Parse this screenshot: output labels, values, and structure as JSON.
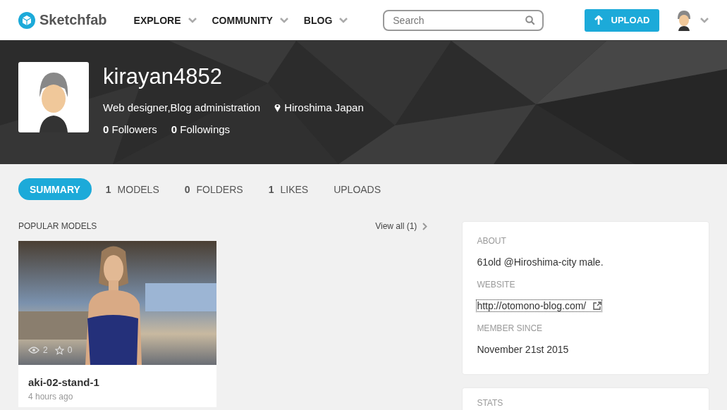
{
  "header": {
    "logo": "Sketchfab",
    "nav": [
      {
        "label": "EXPLORE"
      },
      {
        "label": "COMMUNITY"
      },
      {
        "label": "BLOG"
      }
    ],
    "search": {
      "placeholder": "Search"
    },
    "upload": "UPLOAD"
  },
  "profile": {
    "username": "kirayan4852",
    "bio": "Web designer,Blog administration",
    "location": "Hiroshima Japan",
    "followers": {
      "count": "0",
      "label": "Followers"
    },
    "followings": {
      "count": "0",
      "label": "Followings"
    }
  },
  "tabs": [
    {
      "label": "SUMMARY",
      "selected": true
    },
    {
      "count": "1",
      "label": "MODELS",
      "selected": false
    },
    {
      "count": "0",
      "label": "FOLDERS",
      "selected": false
    },
    {
      "count": "1",
      "label": "LIKES",
      "selected": false
    },
    {
      "label": "UPLOADS",
      "selected": false
    }
  ],
  "popular": {
    "title": "POPULAR MODELS",
    "view_all": "View all (1)",
    "models": [
      {
        "kind": "picture",
        "views": "2",
        "likes": "0",
        "name": "aki-02-stand-1",
        "time": "4 hours ago"
      }
    ]
  },
  "about": {
    "sections": [
      {
        "heading": "ABOUT",
        "value": "61old @Hiroshima-city male.",
        "kind": "text"
      },
      {
        "heading": "WEBSITE",
        "value": "http://otomono-blog.com/",
        "kind": "link"
      },
      {
        "heading": "MEMBER SINCE",
        "value": "November 21st 2015",
        "kind": "text"
      }
    ]
  },
  "stats": {
    "heading": "STATS"
  }
}
